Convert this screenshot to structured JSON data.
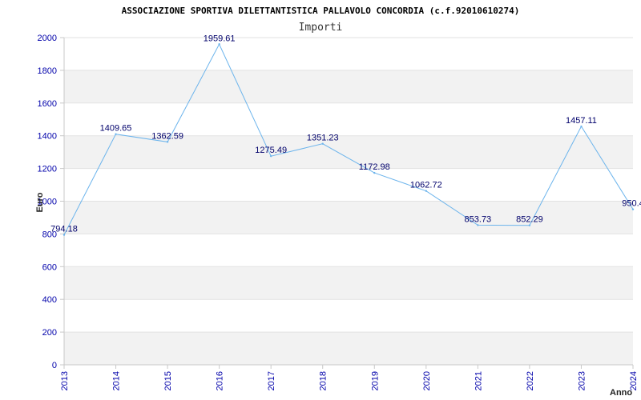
{
  "chart_data": {
    "type": "line",
    "title": "ASSOCIAZIONE SPORTIVA DILETTANTISTICA PALLAVOLO CONCORDIA (c.f.92010610274)",
    "subtitle": "Importi",
    "xlabel": "Anno",
    "ylabel": "Euro",
    "ylim": [
      0,
      2000
    ],
    "yticks": [
      "0",
      "200",
      "400",
      "600",
      "800",
      "1000",
      "1200",
      "1400",
      "1600",
      "1800",
      "2000"
    ],
    "categories": [
      "2013",
      "2014",
      "2015",
      "2016",
      "2017",
      "2018",
      "2019",
      "2020",
      "2021",
      "2022",
      "2023",
      "2024"
    ],
    "series": [
      {
        "values": [
          794.18,
          1409.65,
          1362.59,
          1959.61,
          1275.49,
          1351.23,
          1172.98,
          1062.72,
          853.73,
          852.29,
          1457.11,
          950.4
        ],
        "labels": [
          "794.18",
          "1409.65",
          "1362.59",
          "1959.61",
          "1275.49",
          "1351.23",
          "1172.98",
          "1062.72",
          "853.73",
          "852.29",
          "1457.11",
          "950.4"
        ]
      }
    ],
    "grid": true,
    "colors": {
      "line": "#6cb4ec",
      "band": "#f2f2f2",
      "axis": "#c8c8c8",
      "tick_text": "#0000aa",
      "label_text": "#00006b"
    }
  }
}
